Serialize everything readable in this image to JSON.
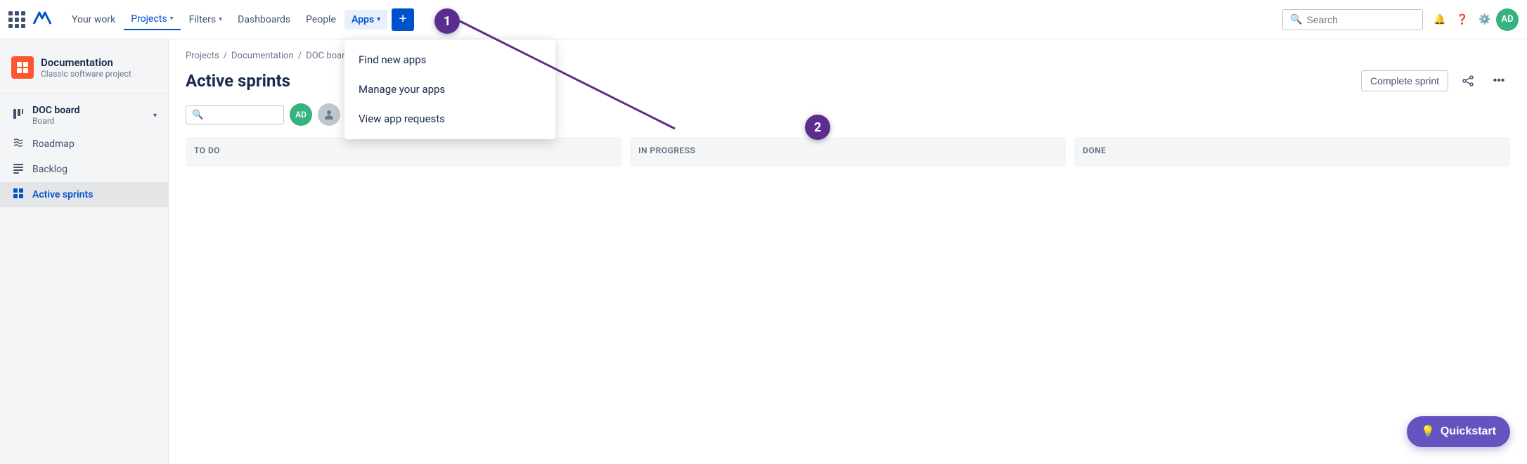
{
  "nav": {
    "items": [
      {
        "id": "your-work",
        "label": "Your work",
        "active": false,
        "hasChevron": false
      },
      {
        "id": "projects",
        "label": "Projects",
        "active": true,
        "hasChevron": true
      },
      {
        "id": "filters",
        "label": "Filters",
        "active": false,
        "hasChevron": true
      },
      {
        "id": "dashboards",
        "label": "Dashboards",
        "active": false,
        "hasChevron": false
      },
      {
        "id": "people",
        "label": "People",
        "active": false,
        "hasChevron": false
      },
      {
        "id": "apps",
        "label": "Apps",
        "active": false,
        "hasChevron": true
      }
    ],
    "search_placeholder": "Search",
    "user_initials": "AD",
    "plus_label": "+"
  },
  "sidebar": {
    "project_name": "Documentation",
    "project_type": "Classic software project",
    "project_icon_letter": "",
    "items": [
      {
        "id": "doc-board",
        "label": "DOC board",
        "sub": "Board",
        "icon": "⊞",
        "hasChevron": true,
        "active": false
      },
      {
        "id": "roadmap",
        "label": "Roadmap",
        "icon": "⤵",
        "active": false
      },
      {
        "id": "backlog",
        "label": "Backlog",
        "icon": "☰",
        "active": false
      },
      {
        "id": "active-sprints",
        "label": "Active sprints",
        "icon": "⊟",
        "active": true
      }
    ]
  },
  "main": {
    "breadcrumb": [
      "Projects",
      "Documentation",
      "DOC board"
    ],
    "page_title": "Active sprints",
    "complete_sprint_label": "Complete sprint",
    "board_columns": [
      {
        "id": "todo",
        "label": "TO DO"
      },
      {
        "id": "in-progress",
        "label": "IN PROGRESS"
      },
      {
        "id": "done",
        "label": "DONE"
      }
    ]
  },
  "apps_dropdown": {
    "items": [
      {
        "id": "find-new-apps",
        "label": "Find new apps"
      },
      {
        "id": "manage-your-apps",
        "label": "Manage your apps"
      },
      {
        "id": "view-app-requests",
        "label": "View app requests"
      }
    ]
  },
  "annotations": {
    "circle1": {
      "label": "1"
    },
    "circle2": {
      "label": "2"
    }
  },
  "quickstart": {
    "label": "Quickstart",
    "icon": "💡"
  }
}
